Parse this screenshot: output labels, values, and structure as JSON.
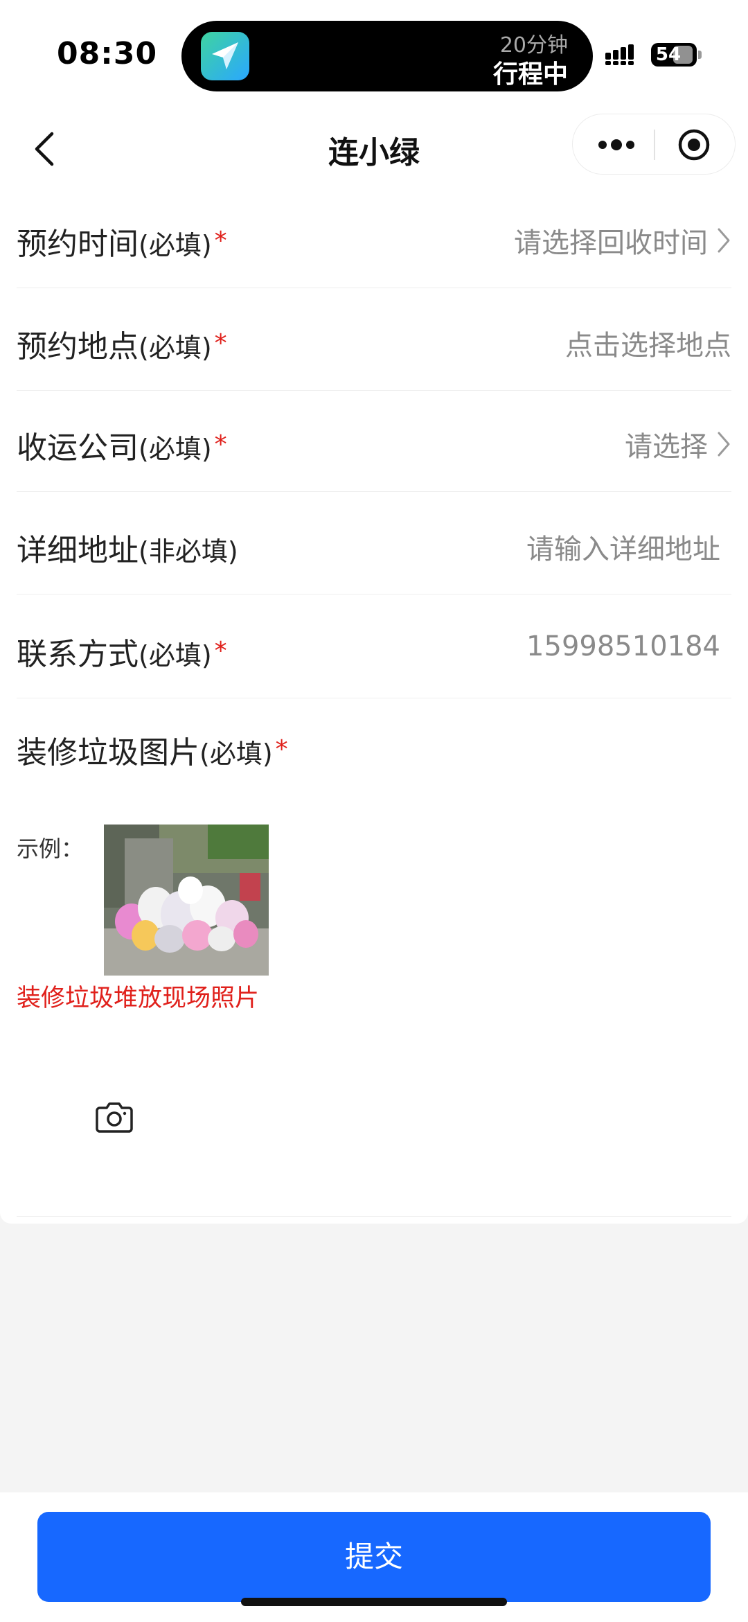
{
  "status_bar": {
    "time": "08:30",
    "island_top": "20分钟",
    "island_bottom": "行程中",
    "battery": "54"
  },
  "nav": {
    "title": "连小绿"
  },
  "form": {
    "rows": [
      {
        "label": "预约时间",
        "note": "(必填)",
        "required": "*",
        "value": "请选择回收时间"
      },
      {
        "label": "预约地点",
        "note": "(必填)",
        "required": "*",
        "value": "点击选择地点"
      },
      {
        "label": "收运公司",
        "note": "(必填)",
        "required": "*",
        "value": "请选择"
      },
      {
        "label": "详细地址",
        "note": "(非必填)",
        "required": "",
        "value": "请输入详细地址"
      },
      {
        "label": "联系方式",
        "note": "(必填)",
        "required": "*",
        "value": "15998510184"
      }
    ],
    "upload": {
      "label": "装修垃圾图片",
      "note": "(必填)",
      "required": "*",
      "example_label": "示例：",
      "example_caption": "装修垃圾堆放现场照片"
    }
  },
  "submit_label": "提交",
  "colors": {
    "accent": "#1768ff",
    "required": "#e0201b",
    "placeholder": "#8a8a8a"
  }
}
